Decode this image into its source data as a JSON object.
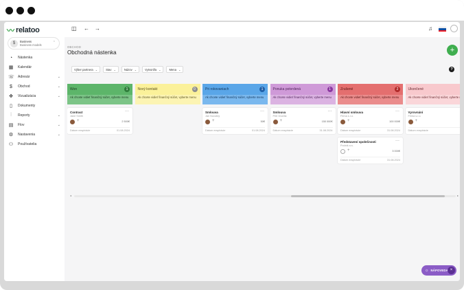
{
  "brand": {
    "logo_text": "relatoo"
  },
  "workspace": {
    "name": "Business",
    "role": "Business models"
  },
  "sidebar": {
    "items": [
      {
        "label": "Nástenka",
        "icon": "gauge-icon",
        "chevron": false
      },
      {
        "label": "Kalendár",
        "icon": "calendar-icon",
        "chevron": false
      },
      {
        "label": "Adresár",
        "icon": "contacts-icon",
        "chevron": true
      },
      {
        "label": "Obchod",
        "icon": "dollar-icon",
        "chevron": true
      },
      {
        "label": "Vizualizácia",
        "icon": "visualization-icon",
        "chevron": true
      },
      {
        "label": "Dokumenty",
        "icon": "document-icon",
        "chevron": false
      },
      {
        "label": "Reporty",
        "icon": "chart-icon",
        "chevron": true
      },
      {
        "label": "Flov",
        "icon": "flow-icon",
        "chevron": true
      },
      {
        "label": "Nastavenia",
        "icon": "gear-icon",
        "chevron": true
      },
      {
        "label": "Používatelia",
        "icon": "users-icon",
        "chevron": false
      }
    ]
  },
  "main": {
    "breadcrumb": "OBCHOD",
    "title": "Obchodná nástenka",
    "filters": [
      "Výber partnera",
      "Stav",
      "Názov",
      "Vytvoril/a",
      "Mena"
    ]
  },
  "board": {
    "note": "Ak chcete vidieť finančný súčet, vyberte menu",
    "columns": [
      {
        "title": "Won",
        "count": "1",
        "bg": "#5db56a",
        "noteBg": "#7cc487",
        "textColor": "#1c3a20",
        "badge": "#2f7d3b",
        "cards": [
          {
            "title": "Contract",
            "sub": "Jane Smith",
            "amount": "2 500€",
            "date": "01.08.2024",
            "avatar": true
          }
        ]
      },
      {
        "title": "Nový kontakt",
        "count": "0",
        "bg": "#fbf19a",
        "noteBg": "#fcf4b3",
        "textColor": "#5a5320",
        "badge": "#8e8e8e",
        "cards": []
      },
      {
        "title": "Pri rokovaniach",
        "count": "1",
        "bg": "#5aa6e8",
        "noteBg": "#7ab8ee",
        "textColor": "#12355a",
        "badge": "#1f5fa8",
        "cards": [
          {
            "title": "Smlouva",
            "sub": "Jan Novotný",
            "amount": "50€",
            "date": "01.08.2024",
            "avatar": true
          }
        ]
      },
      {
        "title": "Ponuka potvrdená",
        "count": "1",
        "bg": "#cf9ad8",
        "noteBg": "#dbb3e2",
        "textColor": "#4c1f56",
        "badge": "#8a37a0",
        "cards": [
          {
            "title": "Smlouva",
            "sub": "Petr Dvořák",
            "amount": "150 000€",
            "date": "31.08.2024",
            "avatar": true
          }
        ]
      },
      {
        "title": "Zrušené",
        "count": "2",
        "bg": "#e46f6f",
        "noteBg": "#ea8c8c",
        "textColor": "#5a1414",
        "badge": "#b02a2a",
        "cards": [
          {
            "title": "Hlavní smlouva",
            "sub": "Firma s.r.o.",
            "amount": "100 000€",
            "date": "31.08.2024",
            "avatar": true
          },
          {
            "title": "Představení společnosti",
            "sub": "Podnik a.s.",
            "amount": "3 000€",
            "date": "31.08.2024",
            "avatar": false
          }
        ]
      },
      {
        "title": "Ukončené",
        "count": "",
        "bg": "#f8c9cd",
        "noteBg": "#fad6d9",
        "textColor": "#6a2a30",
        "badge": "#c9485a",
        "cards": [
          {
            "title": "Vyrovnání",
            "sub": "Firma s.r.o.",
            "amount": "10",
            "date": "",
            "avatar": true
          }
        ]
      }
    ],
    "date_label": "Dátum exspirácie"
  },
  "help": {
    "label": "NÁPOVEDA"
  }
}
